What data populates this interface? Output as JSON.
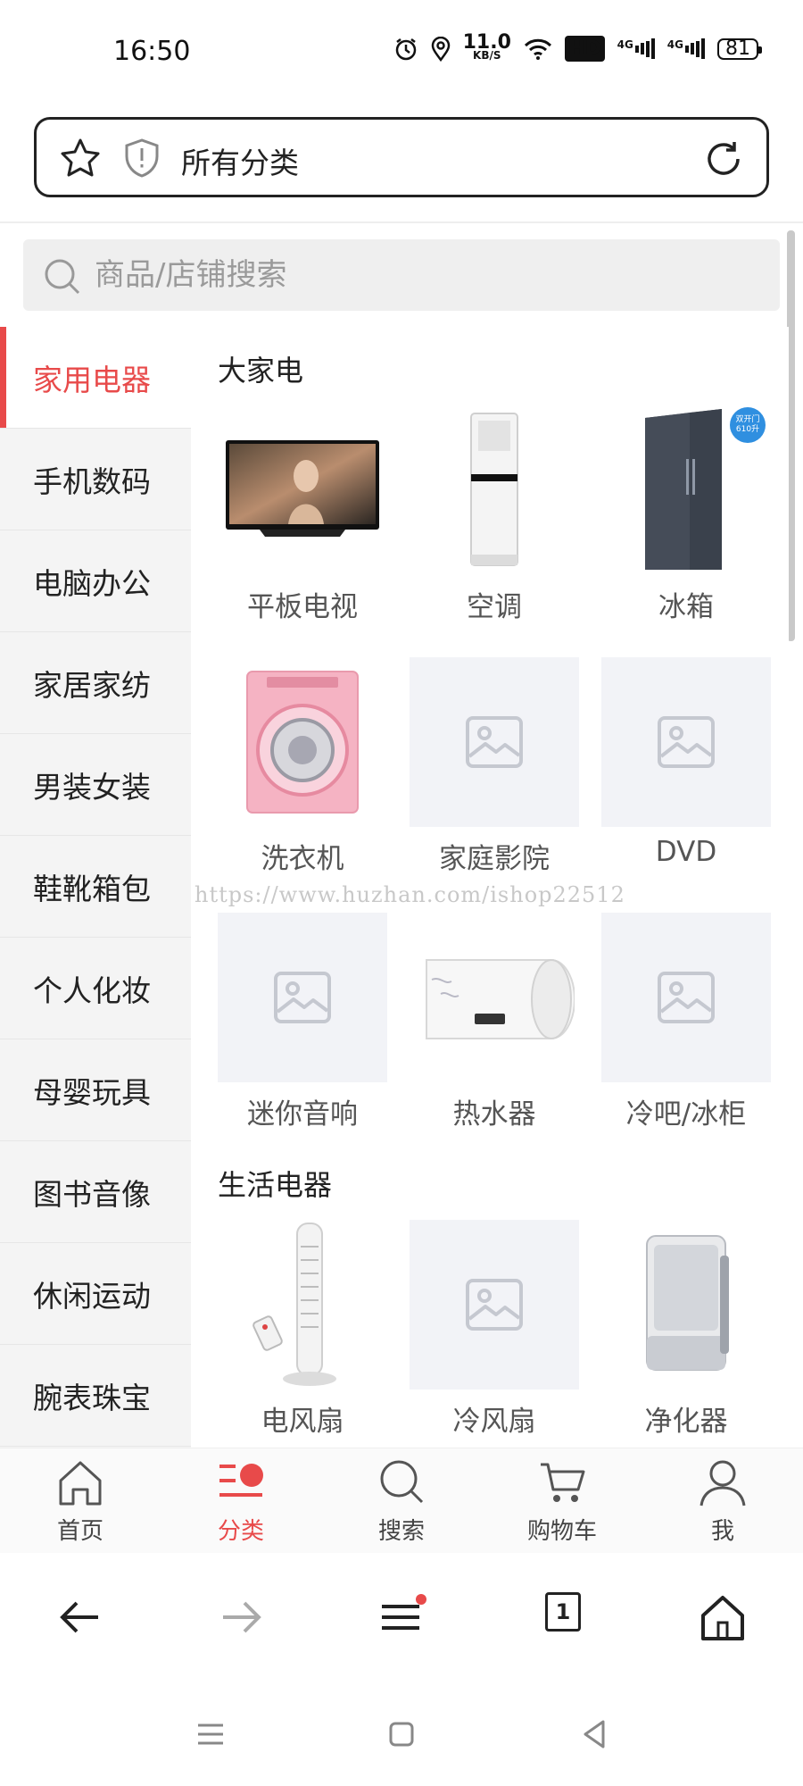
{
  "status_bar": {
    "time": "16:50",
    "speed_value": "11.0",
    "speed_unit": "KB/S",
    "hd_badge": "HD",
    "sim1": "4G",
    "sim2": "4G",
    "battery": "81"
  },
  "address_bar": {
    "title": "所有分类"
  },
  "search": {
    "placeholder": "商品/店铺搜索"
  },
  "sidebar": {
    "items": [
      {
        "label": "家用电器",
        "active": true
      },
      {
        "label": "手机数码"
      },
      {
        "label": "电脑办公"
      },
      {
        "label": "家居家纺"
      },
      {
        "label": "男装女装"
      },
      {
        "label": "鞋靴箱包"
      },
      {
        "label": "个人化妆"
      },
      {
        "label": "母婴玩具"
      },
      {
        "label": "图书音像"
      },
      {
        "label": "休闲运动"
      },
      {
        "label": "腕表珠宝"
      }
    ]
  },
  "content": {
    "sections": [
      {
        "title": "大家电",
        "items": [
          {
            "label": "平板电视",
            "icon": "tv-image"
          },
          {
            "label": "空调",
            "icon": "air-conditioner-image"
          },
          {
            "label": "冰箱",
            "icon": "refrigerator-image",
            "badge_line1": "双开门",
            "badge_line2": "610升"
          },
          {
            "label": "洗衣机",
            "icon": "washing-machine-image"
          },
          {
            "label": "家庭影院",
            "icon": "placeholder-image"
          },
          {
            "label": "DVD",
            "icon": "placeholder-image"
          },
          {
            "label": "迷你音响",
            "icon": "placeholder-image"
          },
          {
            "label": "热水器",
            "icon": "water-heater-image"
          },
          {
            "label": "冷吧/冰柜",
            "icon": "placeholder-image"
          }
        ]
      },
      {
        "title": "生活电器",
        "items": [
          {
            "label": "电风扇",
            "icon": "tower-fan-image"
          },
          {
            "label": "冷风扇",
            "icon": "placeholder-image"
          },
          {
            "label": "净化器",
            "icon": "air-purifier-image"
          }
        ]
      }
    ]
  },
  "watermark": "https://www.huzhan.com/ishop22512",
  "tab_bar": {
    "tabs": [
      {
        "label": "首页",
        "icon": "home-icon"
      },
      {
        "label": "分类",
        "icon": "category-icon",
        "active": true
      },
      {
        "label": "搜索",
        "icon": "search-icon"
      },
      {
        "label": "购物车",
        "icon": "cart-icon"
      },
      {
        "label": "我",
        "icon": "user-icon"
      }
    ]
  },
  "browser_nav": {
    "tab_count": "1"
  },
  "colors": {
    "accent": "#e84a4a",
    "sidebar_bg": "#f4f4f4",
    "placeholder_bg": "#f2f3f7"
  }
}
